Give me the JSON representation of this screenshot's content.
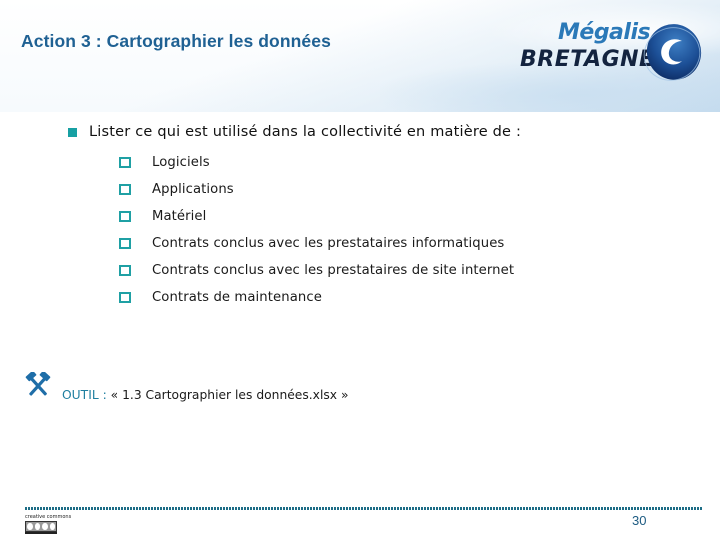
{
  "header": {
    "title": "Action 3 : Cartographier les données",
    "logo": {
      "line1": "Mégalis",
      "line2": "BRETAGNE",
      "mark_icon": "megalis-swirl-logo"
    }
  },
  "content": {
    "main_bullet": "Lister ce qui est utilisé dans la collectivité en matière de :",
    "sub_items": [
      {
        "label": "Logiciels"
      },
      {
        "label": "Applications"
      },
      {
        "label": "Matériel"
      },
      {
        "label": "Contrats conclus avec les prestataires informatiques"
      },
      {
        "label": "Contrats conclus avec les prestataires de site internet"
      },
      {
        "label": "Contrats de maintenance"
      }
    ]
  },
  "tool": {
    "icon": "hammers-crossed-icon",
    "label": "OUTIL :",
    "text": "« 1.3 Cartographier les données.xlsx »"
  },
  "footer": {
    "license_top": "creative commons",
    "license_icon": "cc-by-nc-sa-badge",
    "page_number": "30"
  },
  "colors": {
    "title": "#1f6193",
    "bullet": "#17a0a3",
    "tool_label": "#1f7fa0",
    "footer_rule": "#1d6d86",
    "page_number": "#1d5b82"
  }
}
